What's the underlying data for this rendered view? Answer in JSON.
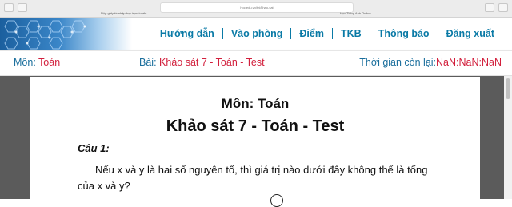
{
  "browser": {
    "url": "hoc.edu.vn/thi/khao-sat",
    "tab_left": "Nộp giấy tờ nhập học trực tuyến",
    "tab_right": "Học Tiếng Anh Online"
  },
  "nav": {
    "items": [
      "Hướng dẫn",
      "Vào phòng",
      "Điểm",
      "TKB",
      "Thông báo",
      "Đăng xuất"
    ]
  },
  "info_bar": {
    "subject_label": "Môn:",
    "subject_value": "Toán",
    "exam_label": "Bài:",
    "exam_value": "Khảo sát 7 - Toán - Test",
    "timer_label": "Thời gian còn lại:",
    "timer_value": "NaN:NaN:NaN"
  },
  "paper": {
    "subject_title": "Môn: Toán",
    "exam_title": "Khảo sát 7 - Toán - Test",
    "question_label": "Câu 1:",
    "question_text": "Nếu x và y là hai số nguyên tố, thì giá trị nào dưới đây không thể là tổng của x và y?"
  },
  "colors": {
    "nav_text": "#0a7aa6",
    "info_label": "#1a6e9c",
    "info_value": "#d21f3c",
    "content_bg": "#5b5b5b"
  },
  "icons": [
    "back-icon",
    "forward-icon",
    "share-icon",
    "tabs-icon"
  ]
}
